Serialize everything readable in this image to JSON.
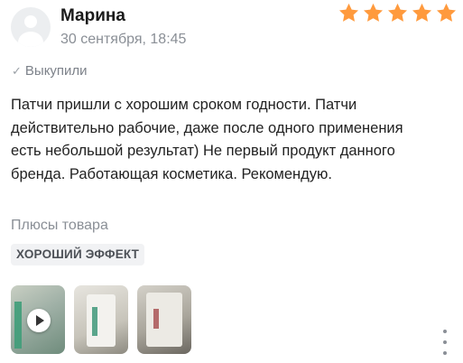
{
  "review": {
    "author": "Марина",
    "date": "30 сентября, 18:45",
    "rating": 5,
    "bought_label": "Выкупили",
    "text": "Патчи пришли с хорошим сроком годности. Патчи действительно рабочие, даже после одного применения есть небольшой результат) Не первый продукт данного бренда. Работающая косметика. Рекомендую.",
    "pros_title": "Плюсы товара",
    "pros_tags": [
      "ХОРОШИЙ ЭФФЕКТ"
    ]
  },
  "media": [
    {
      "type": "video",
      "icon": "play-icon"
    },
    {
      "type": "photo"
    },
    {
      "type": "photo"
    }
  ],
  "colors": {
    "star": "#ff9a3d",
    "secondary_text": "#8a8f96",
    "chip_bg": "#f1f2f4"
  },
  "icons": {
    "avatar": "user-avatar-icon",
    "check": "check-icon",
    "more": "more-vertical-icon"
  }
}
